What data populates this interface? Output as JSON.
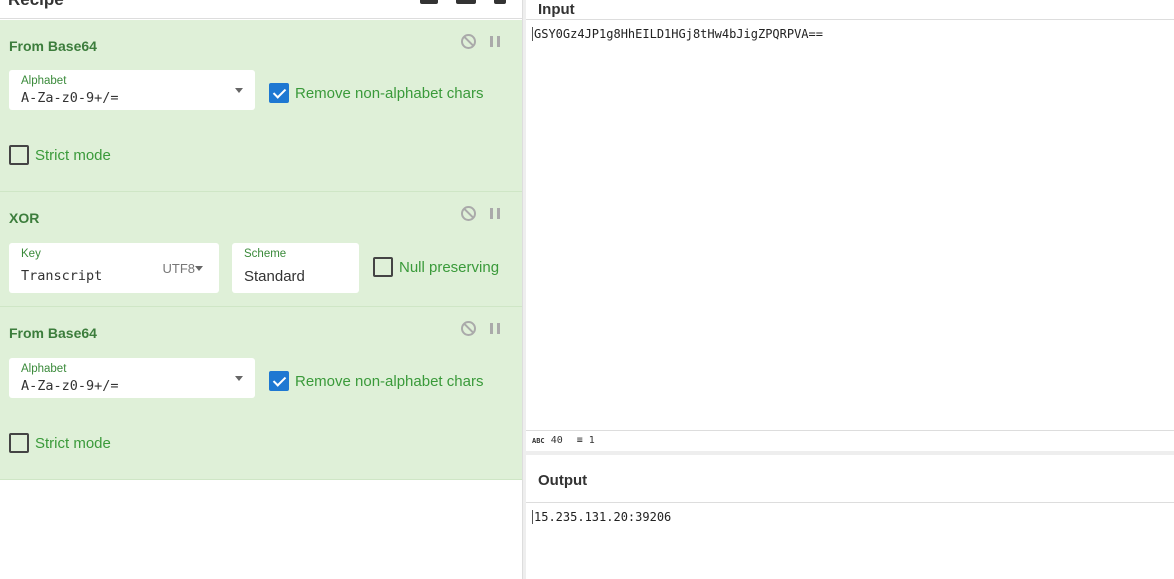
{
  "recipe": {
    "title": "Recipe",
    "ops": [
      {
        "title": "From Base64",
        "alphabet_label": "Alphabet",
        "alphabet": "A-Za-z0-9+/=",
        "remove_label": "Remove non-alphabet chars",
        "remove": true,
        "strict_label": "Strict mode",
        "strict": false
      },
      {
        "title": "XOR",
        "key_label": "Key",
        "key": "Transcript",
        "key_encoding": "UTF8",
        "scheme_label": "Scheme",
        "scheme": "Standard",
        "null_label": "Null preserving",
        "null": false
      },
      {
        "title": "From Base64",
        "alphabet_label": "Alphabet",
        "alphabet": "A-Za-z0-9+/=",
        "remove_label": "Remove non-alphabet chars",
        "remove": true,
        "strict_label": "Strict mode",
        "strict": false
      }
    ]
  },
  "input": {
    "title": "Input",
    "value": "GSY0Gz4JP1g8HhEILD1HGj8tHw4bJigZPQRPVA==",
    "length": "40",
    "lines": "1"
  },
  "output": {
    "title": "Output",
    "value": "15.235.131.20:39206"
  }
}
